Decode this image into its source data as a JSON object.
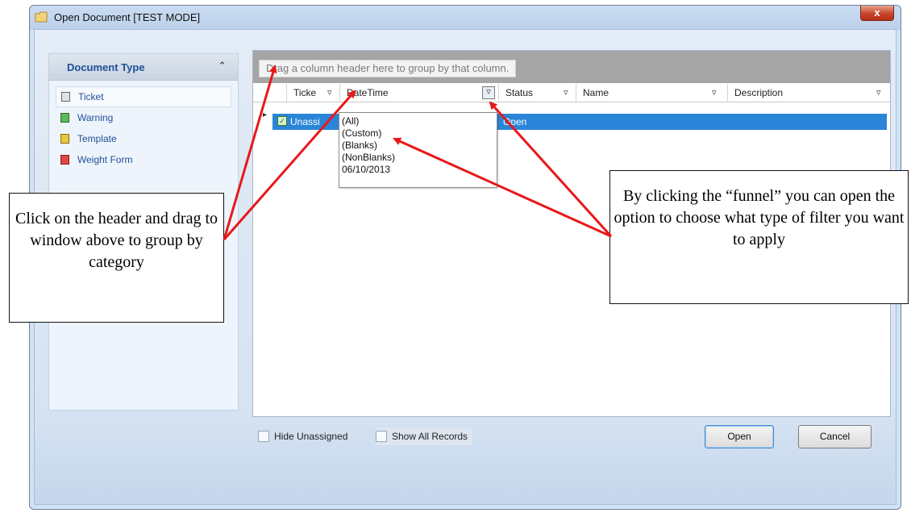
{
  "window": {
    "title": "Open Document [TEST MODE]",
    "close_label": "x"
  },
  "doc_type": {
    "header": "Document Type",
    "items": [
      {
        "label": "Ticket",
        "icon": "ticket-icon",
        "color": "#8a8a8a"
      },
      {
        "label": "Warning",
        "icon": "warning-doc-icon",
        "color": "#3a9a3a"
      },
      {
        "label": "Template",
        "icon": "template-icon",
        "color": "#d4b020"
      },
      {
        "label": "Weight Form",
        "icon": "weight-form-icon",
        "color": "#d03030"
      }
    ]
  },
  "grid": {
    "group_hint": "Drag a column header here to group by that column.",
    "columns": [
      "Ticke",
      "DateTime",
      "Status",
      "Name",
      "Description"
    ],
    "row": {
      "ticket": "Unassi",
      "status": "Open"
    },
    "selected_color": "#2a85d8"
  },
  "filter_dropdown": {
    "options": [
      "(All)",
      "(Custom)",
      "(Blanks)",
      "(NonBlanks)",
      "06/10/2013"
    ]
  },
  "footer": {
    "hide_unassigned": "Hide Unassigned",
    "show_all": "Show All Records",
    "open": "Open",
    "cancel": "Cancel"
  },
  "annotations": {
    "left": "Click on the header and drag to window above to group by category",
    "right": "By clicking the “funnel” you can open the option to choose what type of filter you want to apply",
    "arrow_color": "#e8181a"
  }
}
